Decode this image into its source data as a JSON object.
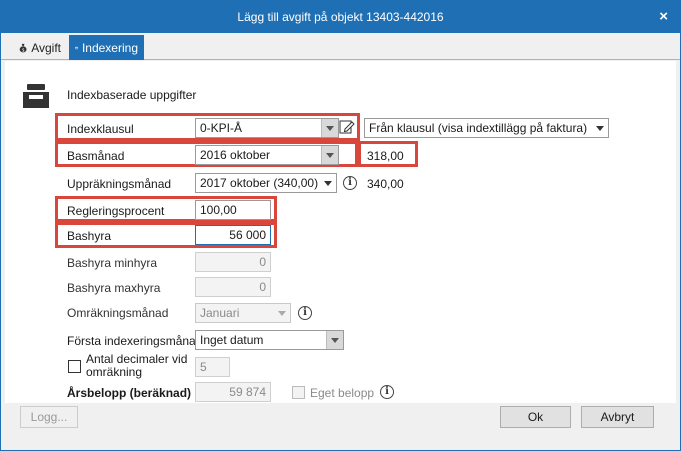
{
  "window": {
    "title": "Lägg till avgift på objekt 13403-442016",
    "close_glyph": "×"
  },
  "tabs": [
    {
      "label": "Avgift",
      "icon": "money-bag-icon",
      "active": false
    },
    {
      "label": "Indexering",
      "icon": "card-icon",
      "active": true
    }
  ],
  "section": {
    "icon": "inbox-tray-icon",
    "heading": "Indexbaserade uppgifter"
  },
  "form": {
    "indexklausul": {
      "label": "Indexklausul",
      "value": "0-KPI-Å",
      "edit_icon": "edit-icon"
    },
    "visning": {
      "value": "Från klausul (visa indextillägg på faktura)"
    },
    "basmanad": {
      "label": "Basmånad",
      "value": "2016 oktober",
      "index_value": "318,00"
    },
    "upprakningsmanad": {
      "label": "Uppräkningsmånad",
      "value": "2017 oktober (340,00)",
      "index_value": "340,00"
    },
    "regleringsprocent": {
      "label": "Regleringsprocent",
      "value": "100,00"
    },
    "bashyra": {
      "label": "Bashyra",
      "value": "56 000"
    },
    "bashyra_min": {
      "label": "Bashyra minhyra",
      "value": "0"
    },
    "bashyra_max": {
      "label": "Bashyra maxhyra",
      "value": "0"
    },
    "omrakningsmanad": {
      "label": "Omräkningsmånad",
      "value": "Januari"
    },
    "forsta_indexeringsmanad": {
      "label": "Första indexeringsmånad",
      "value": "Inget datum"
    },
    "antal_decimaler": {
      "label_line1": "Antal decimaler vid",
      "label_line2": "omräkning",
      "value": "5",
      "checked": false
    },
    "arsbelopp": {
      "label": "Årsbelopp (beräknad)",
      "value": "59 874"
    },
    "eget_belopp": {
      "label": "Eget belopp",
      "checked": false
    }
  },
  "buttons": {
    "logg": "Logg...",
    "ok": "Ok",
    "avbryt": "Avbryt"
  },
  "colors": {
    "accent": "#1f6fb5",
    "highlight": "#d9463b"
  }
}
